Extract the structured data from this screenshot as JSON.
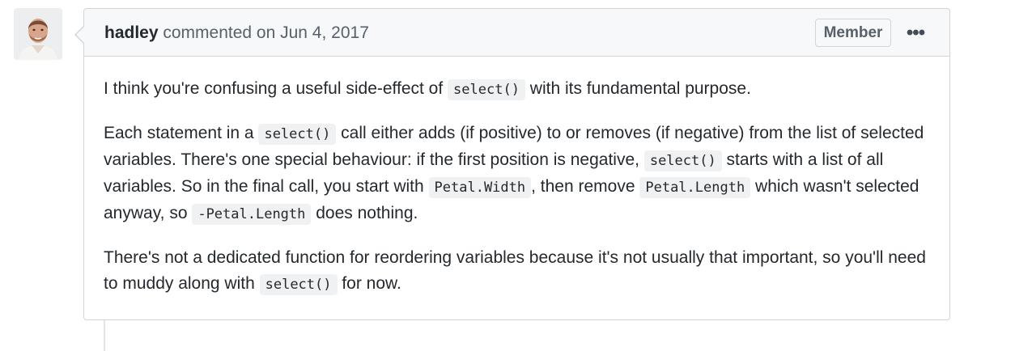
{
  "comment": {
    "author": "hadley",
    "action_text": " commented on Jun 4, 2017",
    "badge": "Member",
    "more_label": "•••",
    "avatar_icon": "user-avatar-icon",
    "paragraphs": [
      [
        {
          "t": "text",
          "v": "I think you're confusing a useful side-effect of "
        },
        {
          "t": "code",
          "v": "select()"
        },
        {
          "t": "text",
          "v": " with its fundamental purpose."
        }
      ],
      [
        {
          "t": "text",
          "v": "Each statement in a "
        },
        {
          "t": "code",
          "v": "select()"
        },
        {
          "t": "text",
          "v": " call either adds (if positive) to or removes (if negative) from the list of selected variables. There's one special behaviour: if the first position is negative, "
        },
        {
          "t": "code",
          "v": "select()"
        },
        {
          "t": "text",
          "v": " starts with a list of all variables. So in the final call, you start with "
        },
        {
          "t": "code",
          "v": "Petal.Width"
        },
        {
          "t": "text",
          "v": ", then remove "
        },
        {
          "t": "code",
          "v": "Petal.Length"
        },
        {
          "t": "text",
          "v": " which wasn't selected anyway, so "
        },
        {
          "t": "code",
          "v": "-Petal.Length"
        },
        {
          "t": "text",
          "v": " does nothing."
        }
      ],
      [
        {
          "t": "text",
          "v": "There's not a dedicated function for reordering variables because it's not usually that important, so you'll need to muddy along with "
        },
        {
          "t": "code",
          "v": "select()"
        },
        {
          "t": "text",
          "v": " for now."
        }
      ]
    ]
  },
  "colors": {
    "header_bg": "#f6f8fa",
    "border": "#d1d5da",
    "text": "#24292e",
    "muted": "#586069",
    "code_bg": "#f0f1f2"
  }
}
